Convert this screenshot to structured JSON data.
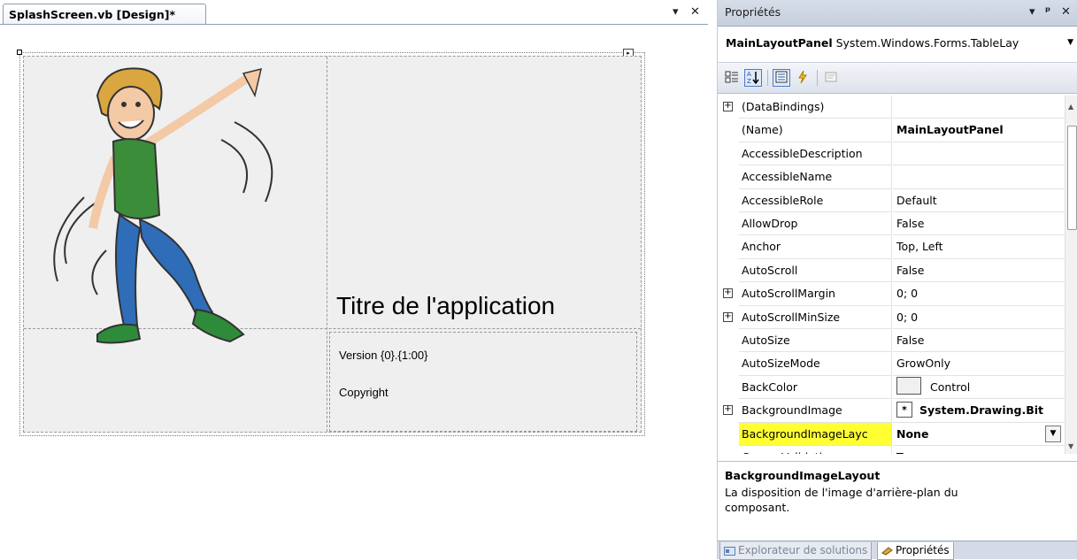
{
  "designer": {
    "tab_label": "SplashScreen.vb [Design]*",
    "tab_dropdown": "▾",
    "tab_close": "✕",
    "app_title": "Titre de l'application",
    "version_text": "Version {0}.{1:00}",
    "copyright_text": "Copyright",
    "smart_tag": "▸"
  },
  "properties": {
    "pane_title": "Propriétés",
    "pane_controls": {
      "menu": "▾",
      "pin": "ᵖ",
      "close": "✕"
    },
    "object_name": "MainLayoutPanel",
    "object_type": "System.Windows.Forms.TableLay",
    "toolbar": {
      "categorized_icon": "categorized-icon",
      "alphabetical_icon": "alphabetical-icon",
      "properties_icon": "properties-icon",
      "events_icon": "events-icon",
      "property_pages_icon": "property-pages-icon"
    },
    "rows": [
      {
        "name": "(DataBindings)",
        "value": "",
        "expandable": true
      },
      {
        "name": "(Name)",
        "value": "MainLayoutPanel",
        "bold": true
      },
      {
        "name": "AccessibleDescription",
        "value": ""
      },
      {
        "name": "AccessibleName",
        "value": ""
      },
      {
        "name": "AccessibleRole",
        "value": "Default"
      },
      {
        "name": "AllowDrop",
        "value": "False"
      },
      {
        "name": "Anchor",
        "value": "Top, Left"
      },
      {
        "name": "AutoScroll",
        "value": "False"
      },
      {
        "name": "AutoScrollMargin",
        "value": "0; 0",
        "expandable": true
      },
      {
        "name": "AutoScrollMinSize",
        "value": "0; 0",
        "expandable": true
      },
      {
        "name": "AutoSize",
        "value": "False"
      },
      {
        "name": "AutoSizeMode",
        "value": "GrowOnly"
      },
      {
        "name": "BackColor",
        "value": "Control"
      },
      {
        "name": "BackgroundImage",
        "value": "System.Drawing.Bit",
        "expandable": true,
        "bold": true
      },
      {
        "name": "BackgroundImageLayc",
        "value": "None",
        "bold": true,
        "selected": true
      },
      {
        "name": "CausesValidation",
        "value": "True"
      }
    ],
    "description": {
      "title": "BackgroundImageLayout",
      "text": "La disposition de l'image d'arrière-plan du composant."
    },
    "bottom_tabs": [
      {
        "label": "Explorateur de solutions",
        "active": false
      },
      {
        "label": "Propriétés",
        "active": true
      }
    ],
    "colors": {
      "selection_highlight": "#ffff33",
      "title_bar": "#ccd5e3"
    }
  }
}
